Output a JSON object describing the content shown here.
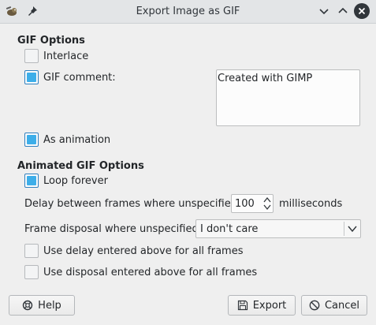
{
  "window": {
    "title": "Export Image as GIF"
  },
  "gif_options": {
    "heading": "GIF Options",
    "interlace": {
      "label": "Interlace",
      "checked": false
    },
    "comment": {
      "label": "GIF comment:",
      "checked": true,
      "value": "Created with GIMP"
    },
    "as_animation": {
      "label": "As animation",
      "checked": true
    }
  },
  "animated_options": {
    "heading": "Animated GIF Options",
    "loop_forever": {
      "label": "Loop forever",
      "checked": true
    },
    "delay": {
      "label": "Delay between frames where unspecified:",
      "value": "100",
      "unit": "milliseconds"
    },
    "disposal": {
      "label": "Frame disposal where unspecified:",
      "value": "I don't care"
    },
    "use_delay_all": {
      "label": "Use delay entered above for all frames",
      "checked": false
    },
    "use_disposal_all": {
      "label": "Use disposal entered above for all frames",
      "checked": false
    }
  },
  "buttons": {
    "help": "Help",
    "export": "Export",
    "cancel": "Cancel"
  },
  "colors": {
    "accent": "#3daee9",
    "window_bg": "#efefef"
  },
  "icons": {
    "app": "gimp-wilber-icon",
    "pin": "pin-icon",
    "minimize": "chevron-down-icon",
    "maximize": "chevron-up-icon",
    "close": "close-icon",
    "help": "help-lifebuoy-icon",
    "export": "save-icon",
    "cancel": "cancel-icon"
  }
}
